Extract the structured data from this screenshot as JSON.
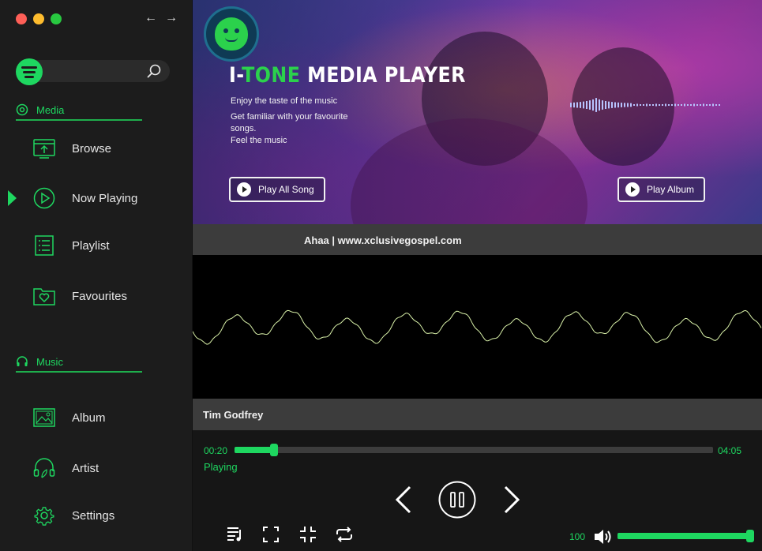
{
  "window": {
    "back_label": "←",
    "forward_label": "→"
  },
  "sidebar": {
    "media_section": "Media",
    "music_section": "Music",
    "items": [
      {
        "label": "Browse",
        "icon": "browse-icon"
      },
      {
        "label": "Now Playing",
        "icon": "play-circle-icon",
        "active": true
      },
      {
        "label": "Playlist",
        "icon": "playlist-icon"
      },
      {
        "label": "Favourites",
        "icon": "favourites-folder-icon"
      },
      {
        "label": "Album",
        "icon": "album-image-icon"
      },
      {
        "label": "Artist",
        "icon": "artist-headphones-icon"
      },
      {
        "label": "Settings",
        "icon": "gear-icon"
      }
    ]
  },
  "banner": {
    "title_prefix": "I-",
    "title_accent": "TONE",
    "title_rest": " MEDIA PLAYER",
    "tagline": [
      "Enjoy the taste of the music",
      "Get familiar with your favourite songs.",
      "Feel the music"
    ],
    "play_all_label": "Play All Song",
    "play_album_label": "Play Album"
  },
  "track": {
    "title": "Ahaa | www.xclusivegospel.com",
    "artist": "Tim Godfrey"
  },
  "player": {
    "elapsed": "00:20",
    "duration": "04:05",
    "progress_fraction": 0.082,
    "status": "Playing",
    "volume": "100",
    "volume_fraction": 1.0
  },
  "colors": {
    "accent": "#1ed760",
    "sidebar_bg": "#1c1c1c",
    "bar_bg": "#3c3c3c"
  }
}
